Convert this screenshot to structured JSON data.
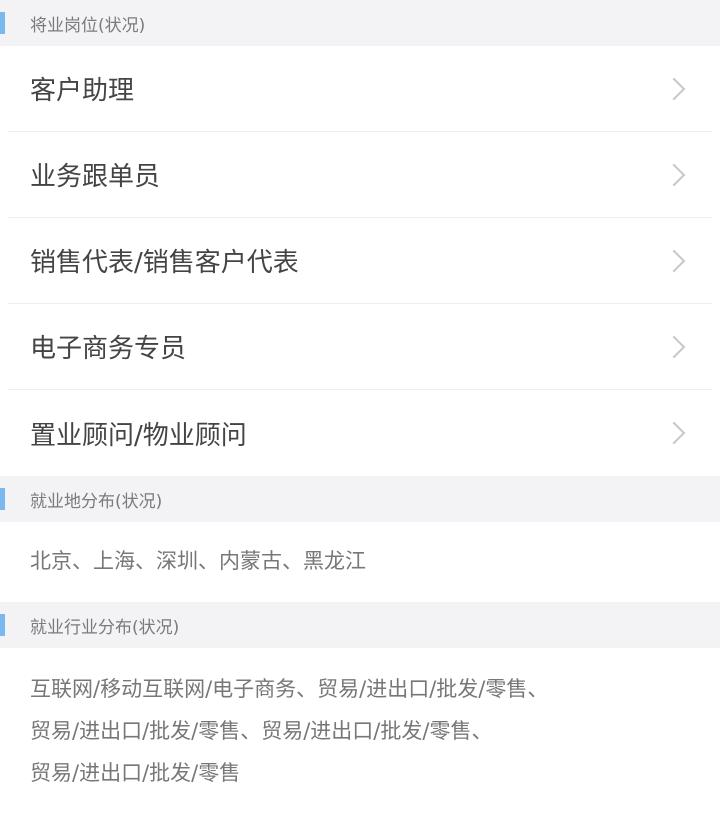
{
  "sections": {
    "positions_header": "将业岗位(状况)",
    "positions": [
      {
        "label": "客户助理"
      },
      {
        "label": "业务跟单员"
      },
      {
        "label": "销售代表/销售客户代表"
      },
      {
        "label": "电子商务专员"
      },
      {
        "label": "置业顾问/物业顾问"
      }
    ],
    "cities_header": "就业地分布(状况)",
    "cities_text": "北京、上海、深圳、内蒙古、黑龙江",
    "industries_header": "就业行业分布(状况)",
    "industries_text_line1": "互联网/移动互联网/电子商务、贸易/进出口/批发/零售、",
    "industries_text_line2": "贸易/进出口/批发/零售、贸易/进出口/批发/零售、",
    "industries_text_line3": "贸易/进出口/批发/零售"
  }
}
